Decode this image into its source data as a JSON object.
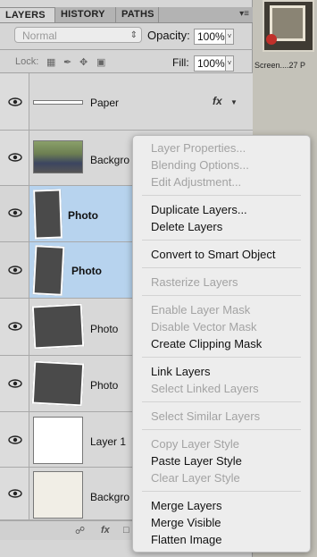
{
  "panel": {
    "tabs": [
      "LAYERS",
      "HISTORY",
      "PATHS"
    ],
    "menu_icon": "panel-menu-icon",
    "blend_mode": "Normal",
    "opacity_label": "Opacity:",
    "opacity_value": "100%",
    "lock_label": "Lock:",
    "fill_label": "Fill:",
    "fill_value": "100%"
  },
  "document_thumb": {
    "label": "Screen....27 P"
  },
  "layers": [
    {
      "name": "Paper",
      "selected": false,
      "bold": false,
      "fx": "fx"
    },
    {
      "name": "Backgro",
      "selected": false,
      "bold": false
    },
    {
      "name": "Photo",
      "selected": true,
      "bold": true
    },
    {
      "name": "Photo",
      "selected": true,
      "bold": true
    },
    {
      "name": "Photo",
      "selected": false,
      "bold": false
    },
    {
      "name": "Photo",
      "selected": false,
      "bold": false
    },
    {
      "name": "Layer 1",
      "selected": false,
      "bold": false
    },
    {
      "name": "Backgro",
      "selected": false,
      "bold": false
    }
  ],
  "bottom_bar": {
    "link_icon": "link-icon",
    "fx_label": "fx"
  },
  "context_menu": {
    "groups": [
      [
        {
          "label": "Layer Properties...",
          "enabled": false
        },
        {
          "label": "Blending Options...",
          "enabled": false
        },
        {
          "label": "Edit Adjustment...",
          "enabled": false
        }
      ],
      [
        {
          "label": "Duplicate Layers...",
          "enabled": true
        },
        {
          "label": "Delete Layers",
          "enabled": true
        }
      ],
      [
        {
          "label": "Convert to Smart Object",
          "enabled": true
        }
      ],
      [
        {
          "label": "Rasterize Layers",
          "enabled": false
        }
      ],
      [
        {
          "label": "Enable Layer Mask",
          "enabled": false
        },
        {
          "label": "Disable Vector Mask",
          "enabled": false
        },
        {
          "label": "Create Clipping Mask",
          "enabled": true
        }
      ],
      [
        {
          "label": "Link Layers",
          "enabled": true
        },
        {
          "label": "Select Linked Layers",
          "enabled": false
        }
      ],
      [
        {
          "label": "Select Similar Layers",
          "enabled": false
        }
      ],
      [
        {
          "label": "Copy Layer Style",
          "enabled": false
        },
        {
          "label": "Paste Layer Style",
          "enabled": true
        },
        {
          "label": "Clear Layer Style",
          "enabled": false
        }
      ],
      [
        {
          "label": "Merge Layers",
          "enabled": true
        },
        {
          "label": "Merge Visible",
          "enabled": true
        },
        {
          "label": "Flatten Image",
          "enabled": true
        }
      ]
    ]
  },
  "colors": {
    "selection": "#b7d3ee",
    "menu_bg": "#ededed",
    "disabled_text": "#a3a3a3"
  }
}
